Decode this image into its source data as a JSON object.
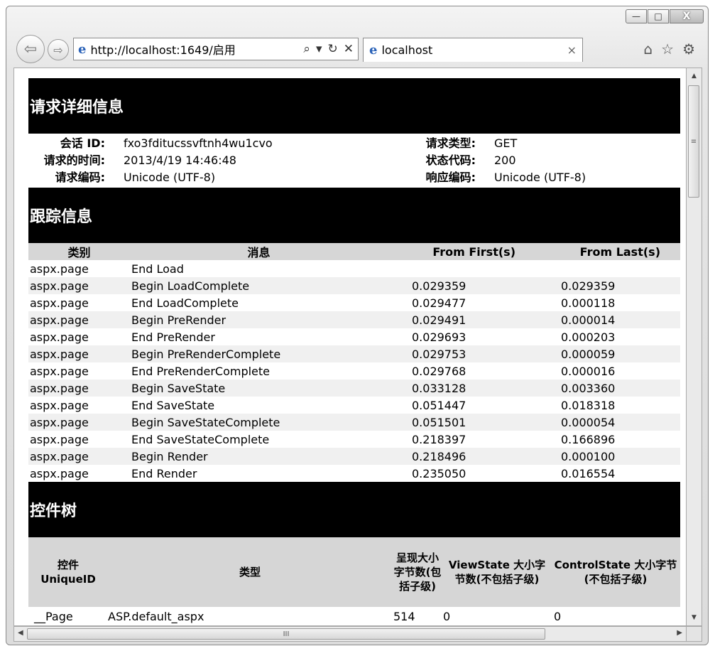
{
  "window": {
    "minimize": "—",
    "maximize": "□",
    "close": "X"
  },
  "nav": {
    "back": "⇦",
    "forward": "⇨",
    "ie_logo": "e",
    "url": "http://localhost:1649/启用",
    "search_glyph": "⌕",
    "refresh_glyph": "↻",
    "stop_glyph": "✕",
    "dropdown_glyph": "▾"
  },
  "tab": {
    "title": "localhost",
    "close": "×"
  },
  "toolbar": {
    "home": "⌂",
    "favorites": "☆",
    "settings": "⚙"
  },
  "request_details": {
    "heading": "请求详细信息",
    "session_id_label": "会话 ID:",
    "session_id": "fxo3fditucssvftnh4wu1cvo",
    "request_time_label": "请求的时间:",
    "request_time": "2013/4/19 14:46:48",
    "request_encoding_label": "请求编码:",
    "request_encoding": "Unicode (UTF-8)",
    "request_type_label": "请求类型:",
    "request_type": "GET",
    "status_code_label": "状态代码:",
    "status_code": "200",
    "response_encoding_label": "响应编码:",
    "response_encoding": "Unicode (UTF-8)"
  },
  "trace": {
    "heading": "跟踪信息",
    "columns": [
      "类别",
      "消息",
      "From First(s)",
      "From Last(s)"
    ],
    "rows": [
      [
        "aspx.page",
        "End Load",
        "",
        ""
      ],
      [
        "aspx.page",
        "Begin LoadComplete",
        "0.029359",
        "0.029359"
      ],
      [
        "aspx.page",
        "End LoadComplete",
        "0.029477",
        "0.000118"
      ],
      [
        "aspx.page",
        "Begin PreRender",
        "0.029491",
        "0.000014"
      ],
      [
        "aspx.page",
        "End PreRender",
        "0.029693",
        "0.000203"
      ],
      [
        "aspx.page",
        "Begin PreRenderComplete",
        "0.029753",
        "0.000059"
      ],
      [
        "aspx.page",
        "End PreRenderComplete",
        "0.029768",
        "0.000016"
      ],
      [
        "aspx.page",
        "Begin SaveState",
        "0.033128",
        "0.003360"
      ],
      [
        "aspx.page",
        "End SaveState",
        "0.051447",
        "0.018318"
      ],
      [
        "aspx.page",
        "Begin SaveStateComplete",
        "0.051501",
        "0.000054"
      ],
      [
        "aspx.page",
        "End SaveStateComplete",
        "0.218397",
        "0.166896"
      ],
      [
        "aspx.page",
        "Begin Render",
        "0.218496",
        "0.000100"
      ],
      [
        "aspx.page",
        "End Render",
        "0.235050",
        "0.016554"
      ]
    ]
  },
  "control_tree": {
    "heading": "控件树",
    "columns": [
      "控件 UniqueID",
      "类型",
      "呈现大小字节数(包括子级)",
      "ViewState 大小字节数(不包括子级)",
      "ControlState 大小字节(不包括子级)"
    ],
    "rows": [
      [
        "__Page",
        "ASP.default_aspx",
        "514",
        "0",
        "0"
      ]
    ]
  },
  "scrollbars": {
    "up": "▲",
    "down": "▼",
    "left": "◀",
    "right": "▶",
    "v_grip": "≡",
    "h_grip": "III"
  }
}
